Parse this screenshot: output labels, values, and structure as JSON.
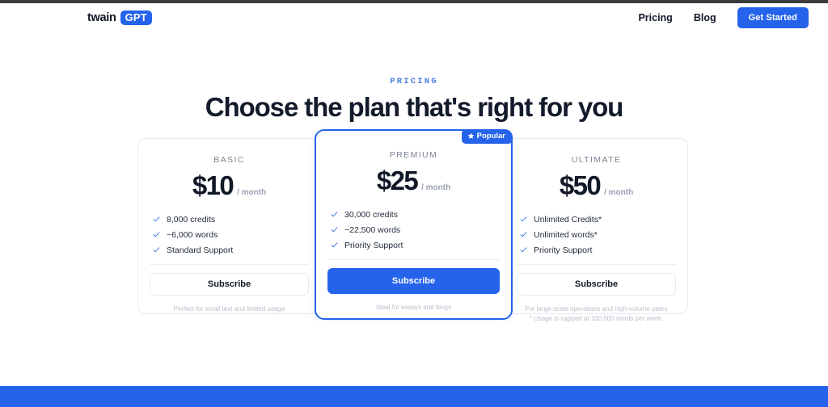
{
  "header": {
    "logo_word": "twain",
    "logo_badge": "GPT",
    "nav": [
      {
        "label": "Pricing"
      },
      {
        "label": "Blog"
      }
    ],
    "cta_label": "Get Started"
  },
  "hero": {
    "eyebrow": "PRICING",
    "headline": "Choose the plan that's right for you"
  },
  "plans": [
    {
      "name": "BASIC",
      "price": "$10",
      "period": "/ month",
      "features": [
        "8,000 credits",
        "~6,000 words",
        "Standard Support"
      ],
      "button_label": "Subscribe",
      "note_line1": "Perfect for small text and limited usage",
      "note_line2": "",
      "badge": ""
    },
    {
      "name": "PREMIUM",
      "price": "$25",
      "period": "/ month",
      "features": [
        "30,000 credits",
        "~22,500 words",
        "Priority Support"
      ],
      "button_label": "Subscribe",
      "note_line1": "Ideal for essays and blogs",
      "note_line2": "",
      "badge": "Popular"
    },
    {
      "name": "ULTIMATE",
      "price": "$50",
      "period": "/ month",
      "features": [
        "Unlimited Credits*",
        "Unlimited words*",
        "Priority Support"
      ],
      "button_label": "Subscribe",
      "note_line1": "For large-scale operations and high-volume users",
      "note_line2": "* Usage is capped at 100,000 words per week.",
      "badge": ""
    }
  ],
  "colors": {
    "brand_blue": "#2563eb",
    "headline": "#131a2b",
    "muted": "#b9bfca",
    "border": "#e7eaf0"
  }
}
